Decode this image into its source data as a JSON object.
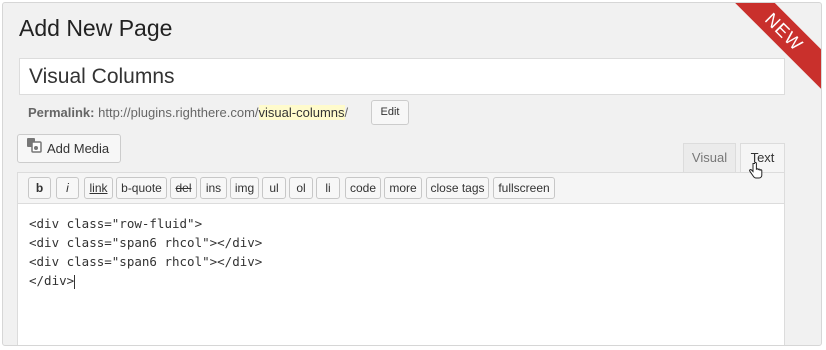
{
  "page_title": "Add New Page",
  "badge": "NEW",
  "title_field": {
    "value": "Visual Columns"
  },
  "permalink": {
    "label": "Permalink:",
    "base": "http://plugins.righthere.com/",
    "slug": "visual-columns",
    "suffix": "/",
    "edit_label": "Edit"
  },
  "add_media": {
    "label": "Add Media",
    "icon": "media-icon"
  },
  "tabs": [
    {
      "label": "Visual"
    },
    {
      "label": "Text"
    }
  ],
  "quicktags": [
    {
      "label": "b"
    },
    {
      "label": "i"
    },
    {
      "label": "link"
    },
    {
      "label": "b-quote"
    },
    {
      "label": "del"
    },
    {
      "label": "ins"
    },
    {
      "label": "img"
    },
    {
      "label": "ul"
    },
    {
      "label": "ol"
    },
    {
      "label": "li"
    },
    {
      "label": "code"
    },
    {
      "label": "more"
    },
    {
      "label": "close tags"
    },
    {
      "label": "fullscreen"
    }
  ],
  "editor": {
    "lines": [
      "<div class=\"row-fluid\">",
      "<div class=\"span6 rhcol\"></div>",
      "<div class=\"span6 rhcol\"></div>",
      "</div>"
    ]
  },
  "colors": {
    "ribbon": "#c9302c",
    "slug_highlight": "#fffbcc"
  }
}
